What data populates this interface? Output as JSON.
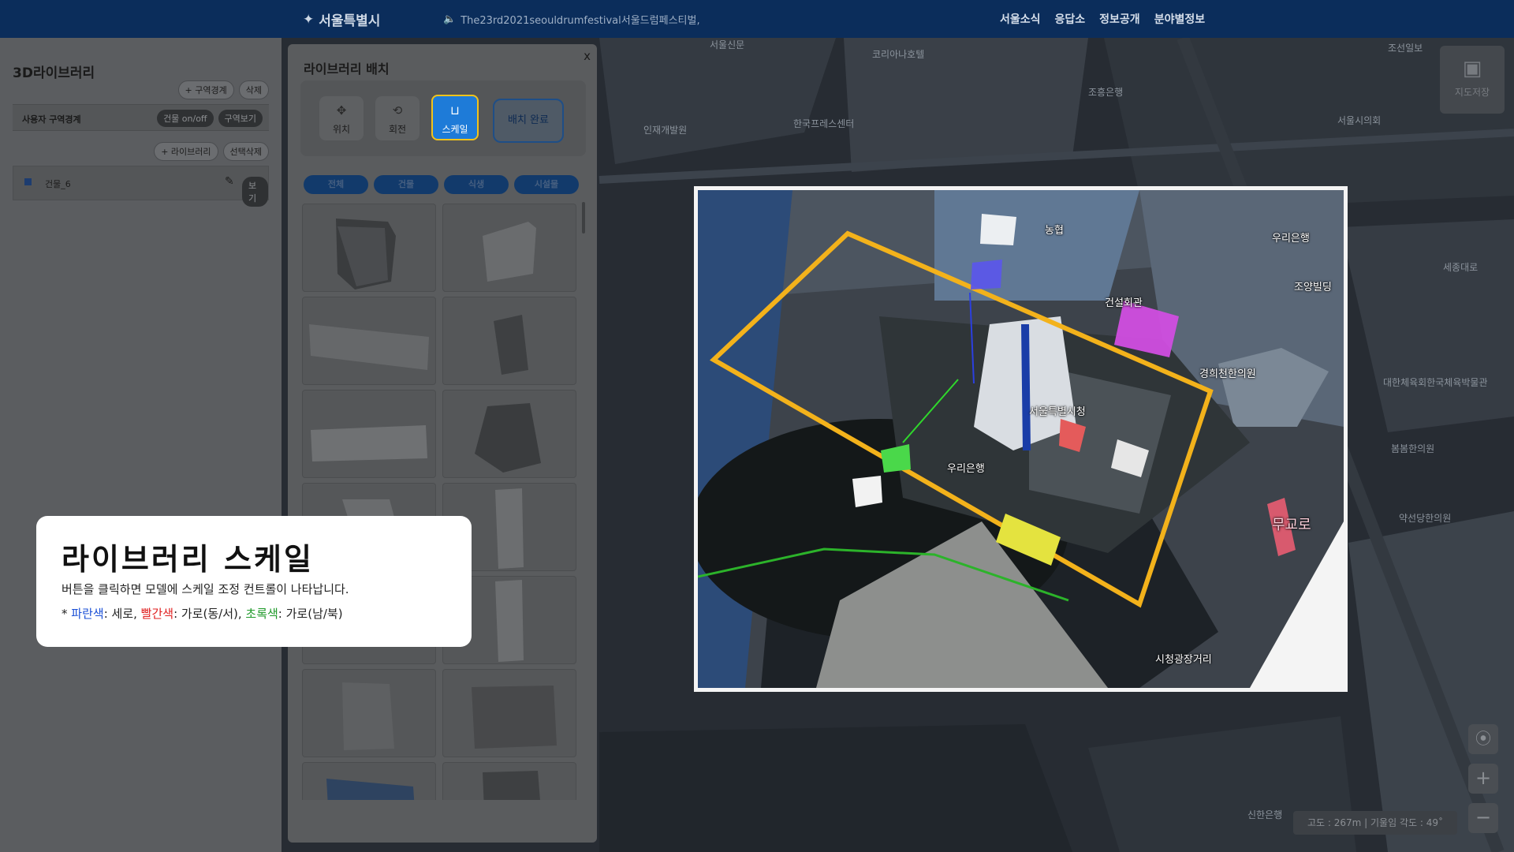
{
  "topbar": {
    "logo": "서울특별시",
    "notice": "The23rd2021seouldrumfestival서울드럼페스티벌,",
    "menu": [
      "서울소식",
      "응답소",
      "정보공개",
      "분야별정보"
    ]
  },
  "library3d": {
    "title": "3D라이브러리",
    "zone_add": "+ 구역경계",
    "zone_delete": "삭제",
    "user_zone_label": "사용자 구역경계",
    "building_toggle": "건물 on/off",
    "zone_view": "구역보기",
    "library_add": "+ 라이브러리",
    "selection_delete": "선택삭제",
    "items": [
      {
        "name": "건물_6",
        "view": "보기"
      }
    ]
  },
  "placement": {
    "title": "라이브러리 배치",
    "close": "x",
    "tools": [
      {
        "label": "위치",
        "icon": "move-icon"
      },
      {
        "label": "회전",
        "icon": "rotate-icon"
      },
      {
        "label": "스케일",
        "icon": "scale-icon",
        "active": true
      }
    ],
    "done": "배치 완료",
    "tabs": [
      "전체",
      "건물",
      "식생",
      "시설물"
    ]
  },
  "map_labels": {
    "overlay": [
      "농협",
      "우리은행",
      "건설회관",
      "조양빌딩",
      "경희천한의원",
      "서울특별시청",
      "우리은행",
      "시청광장거리",
      "무교로"
    ],
    "background": [
      "코리아나호텔",
      "서울신문",
      "한국프레스센터",
      "조흥은행",
      "서울시의회",
      "대한체육회한국체육박물관",
      "봄봄한의원",
      "약선당한의원",
      "인재개발원",
      "신한은행",
      "조선일보",
      "세종대로"
    ]
  },
  "tooltip": {
    "title": "라이브러리 스케일",
    "desc": "버튼을 클릭하면 모델에 스케일 조정 컨트롤이 나타납니다.",
    "legend_prefix": "* ",
    "blue": "파란색",
    "blue_desc": ": 세로, ",
    "red": "빨간색",
    "red_desc": ": 가로(동/서), ",
    "green": "초록색",
    "green_desc": ": 가로(남/북)"
  },
  "controls": {
    "save": "지도저장",
    "zoom_in": "+",
    "zoom_out": "−",
    "status": "고도 : 267m  |  기울임 각도 : 49˚"
  },
  "colors": {
    "accent": "#1e7bd8",
    "highlight": "#f2c31a",
    "blue": "#1a4fd6",
    "red": "#e02020",
    "green": "#1f9a2a"
  }
}
